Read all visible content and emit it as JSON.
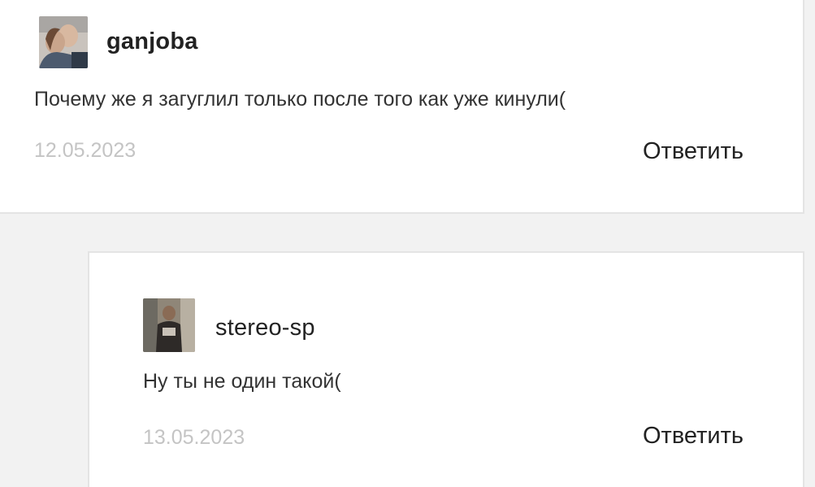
{
  "comments": [
    {
      "username": "ganjoba",
      "text": "Почему же я загуглил только после того как уже кинули(",
      "date": "12.05.2023",
      "reply_label": "Ответить"
    },
    {
      "username": "stereo-sp",
      "text": "Ну ты не один такой(",
      "date": "13.05.2023",
      "reply_label": "Ответить"
    }
  ]
}
